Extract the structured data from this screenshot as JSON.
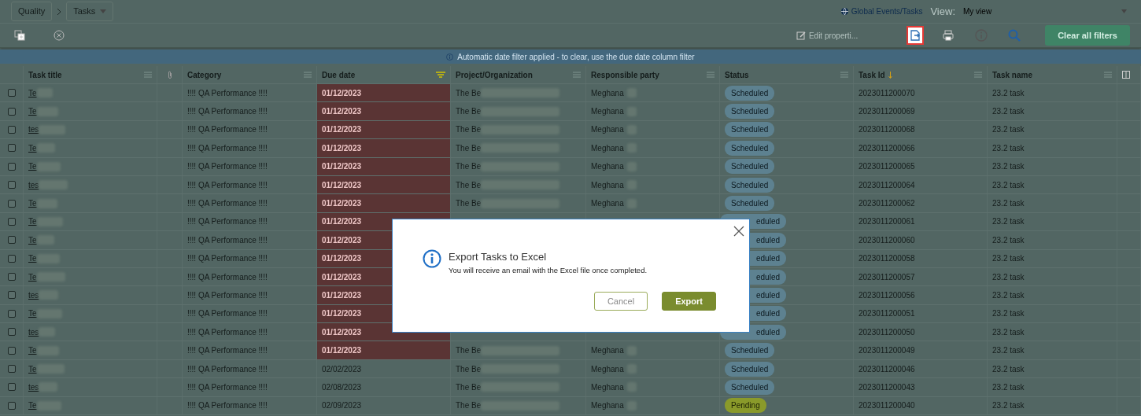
{
  "breadcrumb": {
    "items": [
      "Quality",
      "Tasks"
    ]
  },
  "scope_link": "Global Events/Tasks",
  "view": {
    "label": "View:",
    "value": "My view"
  },
  "toolbar": {
    "edit_button": "Edit properti...",
    "export_highlighted": true,
    "clear_button": "Clear all filters"
  },
  "banner": "Automatic date filter applied - to clear, use the due date column filter",
  "table": {
    "columns": [
      {
        "kind": "text",
        "label": "Task title"
      },
      {
        "kind": "attachment"
      },
      {
        "kind": "text",
        "label": "Category"
      },
      {
        "kind": "text",
        "label": "Due date",
        "filtered": true
      },
      {
        "kind": "text",
        "label": "Project/Organization"
      },
      {
        "kind": "text",
        "label": "Responsible party"
      },
      {
        "kind": "text",
        "label": "Status"
      },
      {
        "kind": "text",
        "label": "Task Id",
        "sorted": true
      },
      {
        "kind": "text",
        "label": "Task name"
      }
    ],
    "rows": [
      {
        "checked": false,
        "title": "Te",
        "category": "!!!! QA Performance !!!!",
        "due": "01/12/2023",
        "overdue": true,
        "project": "The Be",
        "responsible": "Meghana",
        "status": {
          "label": "Scheduled",
          "kind": "scheduled"
        },
        "task_id": "2023011200070",
        "task_name": "23.2 task"
      },
      {
        "checked": false,
        "title": "Te",
        "category": "!!!! QA Performance !!!!",
        "due": "01/12/2023",
        "overdue": true,
        "project": "The Be",
        "responsible": "Meghana",
        "status": {
          "label": "Scheduled",
          "kind": "scheduled"
        },
        "task_id": "2023011200069",
        "task_name": "23.2 task"
      },
      {
        "checked": false,
        "title": "tes",
        "category": "!!!! QA Performance !!!!",
        "due": "01/12/2023",
        "overdue": true,
        "project": "The Be",
        "responsible": "Meghana",
        "status": {
          "label": "Scheduled",
          "kind": "scheduled"
        },
        "task_id": "2023011200068",
        "task_name": "23.2 task"
      },
      {
        "checked": false,
        "title": "Te",
        "category": "!!!! QA Performance !!!!",
        "due": "01/12/2023",
        "overdue": true,
        "project": "The Be",
        "responsible": "Meghana",
        "status": {
          "label": "Scheduled",
          "kind": "scheduled"
        },
        "task_id": "2023011200066",
        "task_name": "23.2 task"
      },
      {
        "checked": false,
        "title": "Te",
        "category": "!!!! QA Performance !!!!",
        "due": "01/12/2023",
        "overdue": true,
        "project": "The Be",
        "responsible": "Meghana",
        "status": {
          "label": "Scheduled",
          "kind": "scheduled"
        },
        "task_id": "2023011200065",
        "task_name": "23.2 task"
      },
      {
        "checked": false,
        "title": "tes",
        "category": "!!!! QA Performance !!!!",
        "due": "01/12/2023",
        "overdue": true,
        "project": "The Be",
        "responsible": "Meghana",
        "status": {
          "label": "Scheduled",
          "kind": "scheduled"
        },
        "task_id": "2023011200064",
        "task_name": "23.2 task"
      },
      {
        "checked": false,
        "title": "Te",
        "category": "!!!! QA Performance !!!!",
        "due": "01/12/2023",
        "overdue": true,
        "project": "The Be",
        "responsible": "Meghana",
        "status": {
          "label": "Scheduled",
          "kind": "scheduled"
        },
        "task_id": "2023011200062",
        "task_name": "23.2 task"
      },
      {
        "checked": false,
        "title": "Te",
        "category": "!!!! QA Performance !!!!",
        "due": "01/12/2023",
        "overdue": true,
        "status": {
          "label": "eduled",
          "kind": "scheduled",
          "clipped": true
        },
        "task_id": "2023011200061",
        "task_name": "23.2 task"
      },
      {
        "checked": false,
        "title": "Te",
        "category": "!!!! QA Performance !!!!",
        "due": "01/12/2023",
        "overdue": true,
        "status": {
          "label": "eduled",
          "kind": "scheduled",
          "clipped": true
        },
        "task_id": "2023011200060",
        "task_name": "23.2 task"
      },
      {
        "checked": false,
        "title": "Te",
        "category": "!!!! QA Performance !!!!",
        "due": "01/12/2023",
        "overdue": true,
        "status": {
          "label": "eduled",
          "kind": "scheduled",
          "clipped": true
        },
        "task_id": "2023011200058",
        "task_name": "23.2 task"
      },
      {
        "checked": false,
        "title": "Te",
        "category": "!!!! QA Performance !!!!",
        "due": "01/12/2023",
        "overdue": true,
        "status": {
          "label": "eduled",
          "kind": "scheduled",
          "clipped": true
        },
        "task_id": "2023011200057",
        "task_name": "23.2 task"
      },
      {
        "checked": false,
        "title": "tes",
        "category": "!!!! QA Performance !!!!",
        "due": "01/12/2023",
        "overdue": true,
        "status": {
          "label": "eduled",
          "kind": "scheduled",
          "clipped": true
        },
        "task_id": "2023011200056",
        "task_name": "23.2 task"
      },
      {
        "checked": false,
        "title": "Te",
        "category": "!!!! QA Performance !!!!",
        "due": "01/12/2023",
        "overdue": true,
        "status": {
          "label": "eduled",
          "kind": "scheduled",
          "clipped": true
        },
        "task_id": "2023011200051",
        "task_name": "23.2 task"
      },
      {
        "checked": false,
        "title": "tes",
        "category": "!!!! QA Performance !!!!",
        "due": "01/12/2023",
        "overdue": true,
        "status": {
          "label": "eduled",
          "kind": "scheduled",
          "clipped": true
        },
        "task_id": "2023011200050",
        "task_name": "23.2 task"
      },
      {
        "checked": false,
        "title": "Te",
        "category": "!!!! QA Performance !!!!",
        "due": "01/12/2023",
        "overdue": true,
        "project": "The Be",
        "responsible": "Meghana",
        "status": {
          "label": "Scheduled",
          "kind": "scheduled"
        },
        "task_id": "2023011200049",
        "task_name": "23.2 task"
      },
      {
        "checked": false,
        "title": "Te",
        "category": "!!!! QA Performance !!!!",
        "due": "02/02/2023",
        "overdue": false,
        "project": "The Be",
        "responsible": "Meghana",
        "status": {
          "label": "Scheduled",
          "kind": "scheduled"
        },
        "task_id": "2023011200046",
        "task_name": "23.2 task"
      },
      {
        "checked": false,
        "title": "tes",
        "category": "!!!! QA Performance !!!!",
        "due": "02/08/2023",
        "overdue": false,
        "project": "The Be",
        "responsible": "Meghana",
        "status": {
          "label": "Scheduled",
          "kind": "scheduled"
        },
        "task_id": "2023011200043",
        "task_name": "23.2 task"
      },
      {
        "checked": false,
        "title": "Te",
        "category": "!!!! QA Performance !!!!",
        "due": "02/09/2023",
        "overdue": false,
        "project": "The Be",
        "responsible": "Meghana",
        "status": {
          "label": "Pending",
          "kind": "pending"
        },
        "task_id": "2023011200040",
        "task_name": "23.2 task"
      }
    ]
  },
  "dialog": {
    "title": "Export Tasks to Excel",
    "message": "You will receive an email with the Excel file once completed.",
    "buttons": [
      {
        "label": "Cancel",
        "kind": "secondary"
      },
      {
        "label": "Export",
        "kind": "primary"
      }
    ]
  }
}
